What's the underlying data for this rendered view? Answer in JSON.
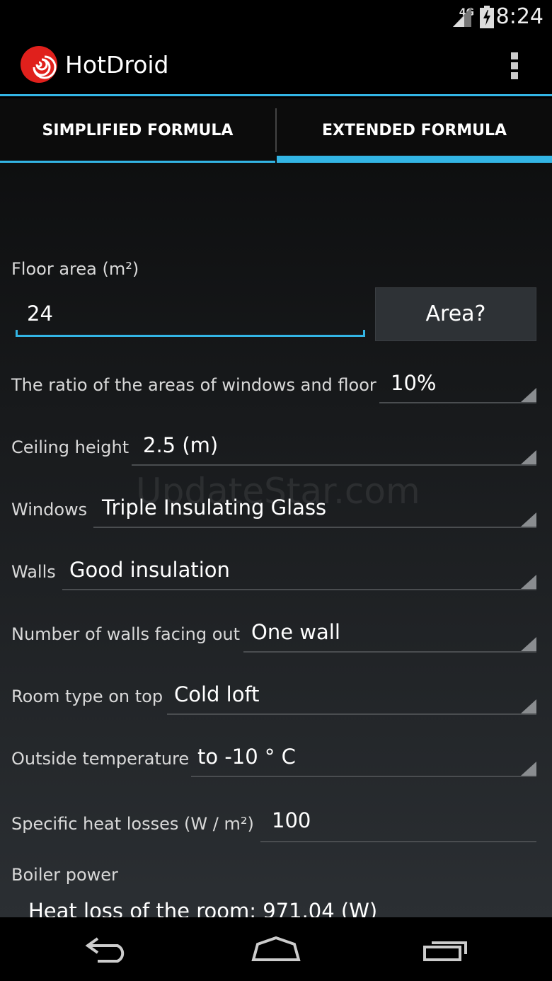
{
  "status_bar": {
    "network": "4G",
    "time": "8:24"
  },
  "app": {
    "title": "HotDroid"
  },
  "tabs": [
    {
      "label": "SIMPLIFIED FORMULA"
    },
    {
      "label": "EXTENDED FORMULA"
    }
  ],
  "form": {
    "floor_area": {
      "label": "Floor area (m²)",
      "value": "24"
    },
    "area_button": "Area?",
    "ratio": {
      "label": "The ratio of the areas of windows and floor",
      "value": "10%"
    },
    "ceiling": {
      "label": "Ceiling height",
      "value": "2.5 (m)"
    },
    "windows": {
      "label": "Windows",
      "value": "Triple Insulating Glass"
    },
    "walls": {
      "label": "Walls",
      "value": "Good insulation"
    },
    "walls_out": {
      "label": "Number of walls facing out",
      "value": "One wall"
    },
    "room_top": {
      "label": "Room type on top",
      "value": "Cold loft"
    },
    "outside_temp": {
      "label": "Outside temperature",
      "value": "to -10 ° C"
    },
    "heat_losses": {
      "label": "Specific heat losses (W / m²)",
      "value": "100"
    }
  },
  "results": {
    "boiler_label": "Boiler power",
    "heat_loss": "Heat loss of the room: 971.04 (W)"
  },
  "watermark": "UpdateStar.com"
}
